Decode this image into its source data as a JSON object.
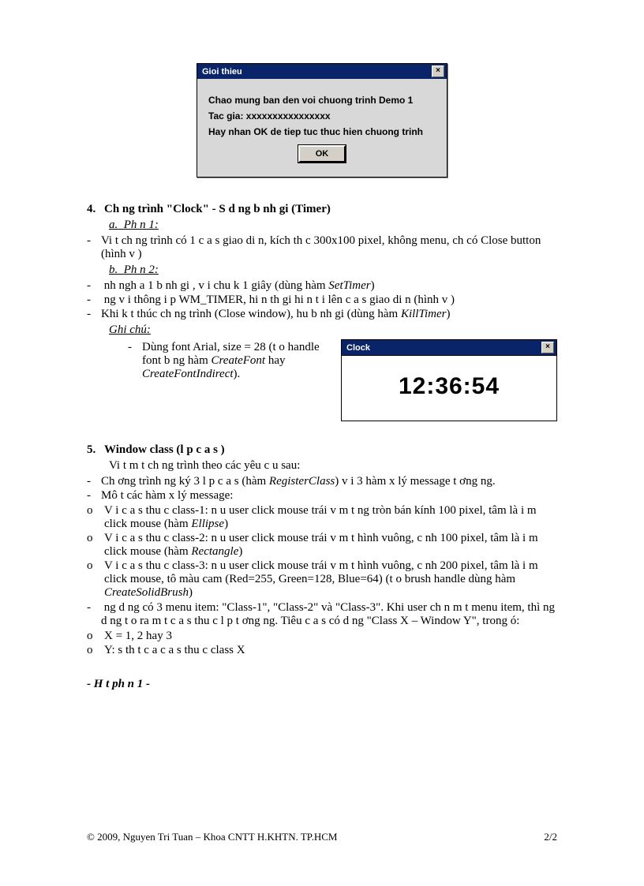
{
  "dialog1": {
    "title": "Gioi thieu",
    "line1": "Chao mung ban den voi chuong trinh Demo 1",
    "line2": "Tac gia: xxxxxxxxxxxxxxxx",
    "line3": "Hay nhan OK de tiep tuc thuc hien chuong trinh",
    "ok": "OK",
    "close": "×"
  },
  "sec4": {
    "num": "4.",
    "title": "Ch   ng trình \"Clock\" - S   d  ng b     nh gi   (Timer)",
    "p1_label": "a.",
    "p1": "Ph  n 1:",
    "p1_i1": "Vi t ch   ng trình có 1 c  a s   giao di n, kích th   c 300x100 pixel, không menu, ch  có Close button (hình v )",
    "p2_label": "b.",
    "p2": "Ph  n 2:",
    "p2_i1_a": "  nh ngh a 1 b    nh gi , v i chu k   1 giây (dùng hàm ",
    "p2_i1_fn": "SetTimer",
    "p2_i1_b": ")",
    "p2_i2": "  ng v i thông  i p WM_TIMER, hi n th  gi   hi n t i lên c a s   giao di n (hình v )",
    "p2_i3_a": "Khi k t thúc ch   ng trình (Close window), hu   b     nh gi   (dùng hàm ",
    "p2_i3_fn": "KillTimer",
    "p2_i3_b": ")",
    "ghichu": "Ghi chú:",
    "note_a": "Dùng font Arial, size = 28 (t o handle font b ng hàm ",
    "note_fn1": "CreateFont",
    "note_mid": " hay ",
    "note_fn2": "CreateFontIndirect",
    "note_b": ")."
  },
  "clock": {
    "title": "Clock",
    "time": "12:36:54",
    "close": "×"
  },
  "sec5": {
    "num": "5.",
    "title": "Window class (l p c a s )",
    "intro": "Vi t m t ch   ng trình theo các yêu c u sau:",
    "i1_a": "Ch  ơng trình   ng ký 3 l p c a s   (hàm ",
    "i1_fn": "RegisterClass",
    "i1_b": ") v i 3 hàm x   lý message t ơng  ng.",
    "i2": "Mô t   các hàm x   lý message:",
    "i2_o1_a": "V i c a s   thu c class-1: n u user click mouse trái   v  m t    ng tròn bán kính 100 pixel, tâm là  i m click mouse (hàm ",
    "i2_o1_fn": "Ellipse",
    "i2_o1_b": ")",
    "i2_o2_a": "V i c a s   thu c class-2: n u user click mouse trái   v  m t hình vuông, c nh 100 pixel, tâm là  i m click mouse (hàm ",
    "i2_o2_fn": "Rectangle",
    "i2_o2_b": ")",
    "i2_o3_a": "V i c a s   thu c class-3: n u user click mouse trái   v  m t hình vuông, c nh 200 pixel, tâm là  i m click mouse, tô màu cam (Red=255, Green=128, Blue=64) (t o brush handle dùng hàm ",
    "i2_o3_fn": "CreateSolidBrush",
    "i2_o3_b": ")",
    "i3": "  ng d ng có 3 menu item: \"Class-1\", \"Class-2\" và \"Class-3\". Khi user ch n m t menu item, thì  ng d ng t o ra m t c a s   thu c l p t  ơng  ng. Tiêu    c a s   có d ng \"Class X – Window Y\", trong  ó:",
    "i3_o1": "X = 1, 2 hay 3",
    "i3_o2": "Y: s   th   t   c a c a s   thu c class X"
  },
  "endnote": "- H t ph  n 1 -",
  "footer": {
    "left": "© 2009, Nguyen Tri Tuan – Khoa CNTT  H.KHTN. TP.HCM",
    "right": "2/2"
  }
}
